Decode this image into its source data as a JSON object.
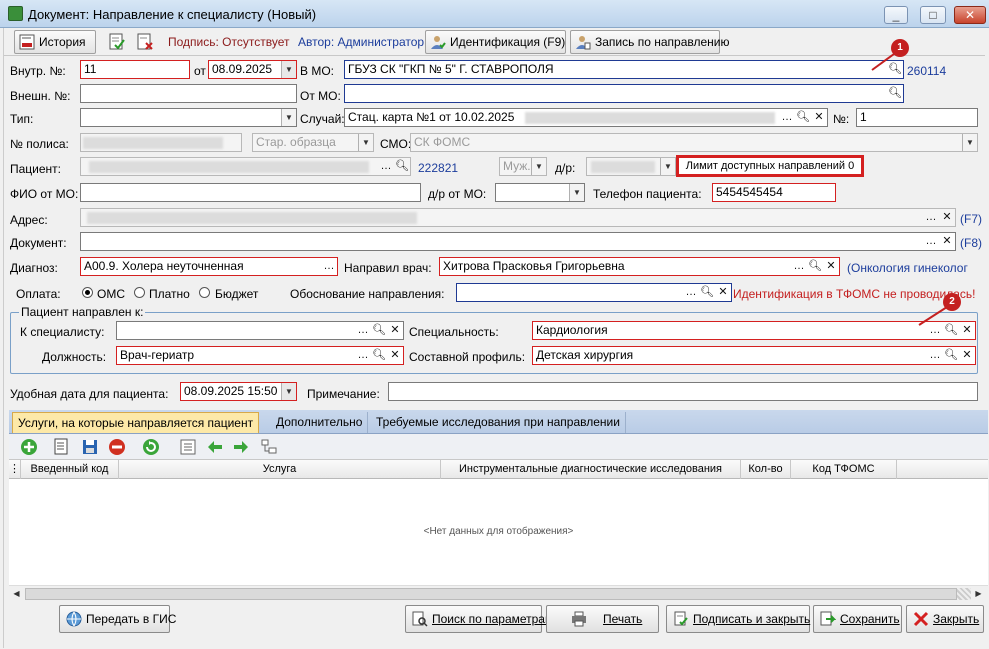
{
  "window": {
    "title": "Документ: Направление к специалисту (Новый)",
    "btn_min": "_",
    "btn_max": "□",
    "btn_close": "✕"
  },
  "toolbar": {
    "history": "История",
    "signature_label": "Подпись: Отсутствует",
    "author_label": "Автор: Администратор",
    "identification": "Идентификация  (F9)",
    "record": "Запись по направлению"
  },
  "form": {
    "internal_no_label": "Внутр. №:",
    "internal_no": "11",
    "date_from_label": "от",
    "date": "08.09.2025",
    "to_mo_label": "В МО:",
    "to_mo": "ГБУЗ СК \"ГКП № 5\" Г. СТАВРОПОЛЯ",
    "to_mo_code": "260114",
    "external_no_label": "Внешн. №:",
    "from_mo_label": "От МО:",
    "type_label": "Тип:",
    "case_label": "Случай:",
    "case_value": "Стац. карта №1 от 10.02.2025",
    "num_label": "№:",
    "num_value": "1",
    "policy_label": "№ полиса:",
    "policy_type": "Стар. образца",
    "smo_label": "СМО:",
    "smo_value": "СК ФОМС",
    "patient_label": "Пациент:",
    "patient_code": "222821",
    "sex_value": "Муж.",
    "dob_label": "д/р:",
    "limit_text": "Лимит доступных направлений 0",
    "fio_mo_label": "ФИО от МО:",
    "dob_mo_label": "д/р от МО:",
    "phone_label": "Телефон пациента:",
    "phone_value": "5454545454",
    "address_label": "Адрес:",
    "address_hotkey": "(F7)",
    "document_label": "Документ:",
    "document_hotkey": "(F8)",
    "diagnosis_label": "Диагноз:",
    "diagnosis_value": "A00.9. Холера неуточненная",
    "doctor_label": "Направил врач:",
    "doctor_value": "Хитрова Прасковья Григорьевна",
    "doctor_dept": "(Онкология гинеколог",
    "payment_label": "Оплата:",
    "pay_oms": "ОМС",
    "pay_paid": "Платно",
    "pay_budget": "Бюджет",
    "reason_label": "Обоснование направления:",
    "tfoms_warning": "Идентификация в ТФОМС не проводилась!",
    "group_label": "Пациент направлен к:",
    "specialist_label": "К специалисту:",
    "specialty_label": "Специальность:",
    "specialty_value": "Кардиология",
    "position_label": "Должность:",
    "position_value": "Врач-гериатр",
    "profile_label": "Составной профиль:",
    "profile_value": "Детская хирургия",
    "convenient_date_label": "Удобная дата для пациента:",
    "convenient_date": "08.09.2025 15:50",
    "note_label": "Примечание:"
  },
  "markers": {
    "m1": "1",
    "m2": "2"
  },
  "tabs": {
    "services": "Услуги, на которые направляется пациент",
    "extra": "Дополнительно",
    "research": "Требуемые исследования при направлении"
  },
  "grid": {
    "columns": [
      "Введенный код",
      "Услуга",
      "Инструментальные диагностические исследования",
      "Кол-во",
      "Код ТФОМС"
    ],
    "empty": "<Нет данных для отображения>"
  },
  "bottom": {
    "gis": "Передать в ГИС",
    "search": "Поиск по параметрам",
    "print": "Печать",
    "sign_close": "Подписать и закрыть",
    "save": "Сохранить",
    "close": "Закрыть"
  },
  "colors": {
    "accent_red": "#d42020",
    "link_blue": "#1c3d9c",
    "tab_active": "#fde9a8"
  }
}
